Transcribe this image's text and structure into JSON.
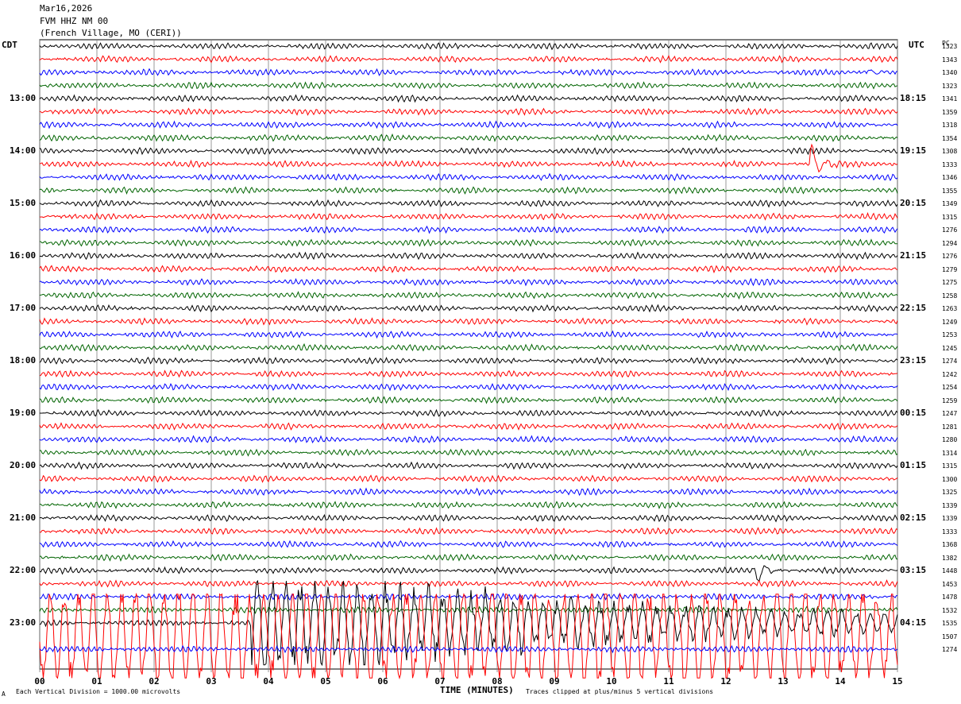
{
  "header": {
    "date": "Mar16,2026",
    "station": "FVM HHZ NM 00",
    "location": "(French Village, MO (CERI))"
  },
  "left_axis_label": "CDT",
  "right_axis_label": "UTC",
  "counts_label": "PC",
  "footer": {
    "scale_note": "Each Vertical Division = 1000.00 microvolts",
    "xlabel": "TIME (MINUTES)",
    "clip_note": "Traces clipped at plus/minus 5 vertical divisions",
    "corner_mark": "A"
  },
  "colors": {
    "line1": "#000000",
    "line2": "#ff0000",
    "line3": "#0000ff",
    "line4": "#006400",
    "grid": "#808080"
  },
  "chart_data": {
    "type": "line",
    "title": "",
    "xlabel": "TIME (MINUTES)",
    "x_ticks": [
      "00",
      "01",
      "02",
      "03",
      "04",
      "05",
      "06",
      "07",
      "08",
      "09",
      "10",
      "11",
      "12",
      "13",
      "14",
      "15"
    ],
    "xlim": [
      0,
      15
    ],
    "traces_per_hour": 4,
    "trace_minutes": 15,
    "left_hour_labels": [
      "13:00",
      "14:00",
      "15:00",
      "16:00",
      "17:00",
      "18:00",
      "19:00",
      "20:00",
      "21:00",
      "22:00",
      "23:00"
    ],
    "right_hour_labels": [
      "18:15",
      "19:15",
      "20:15",
      "21:15",
      "22:15",
      "23:15",
      "00:15",
      "01:15",
      "02:15",
      "03:15",
      "04:15"
    ],
    "trace_counts": [
      "1323",
      "1343",
      "1340",
      "1323",
      "1341",
      "1359",
      "1318",
      "1354",
      "1308",
      "1333",
      "1346",
      "1355",
      "1349",
      "1315",
      "1276",
      "1294",
      "1276",
      "1279",
      "1275",
      "1258",
      "1263",
      "1249",
      "1253",
      "1245",
      "1274",
      "1242",
      "1254",
      "1259",
      "1247",
      "1281",
      "1280",
      "1314",
      "1315",
      "1300",
      "1325",
      "1339",
      "1339",
      "1333",
      "1368",
      "1382",
      "1448",
      "1453",
      "1478",
      "1532",
      "1535",
      "1507",
      "1274"
    ],
    "series": [
      {
        "trace_index": 9,
        "event_minute": 13.45,
        "event_amplitude_divisions": 2.5
      },
      {
        "trace_index": 2,
        "event_minute": 14.45,
        "event_amplitude_divisions": 0.6
      },
      {
        "trace_index": 40,
        "event_minute": 12.5,
        "event_amplitude_divisions": 1.5
      },
      {
        "trace_index": 44,
        "event_minute": 3.7,
        "event_amplitude_divisions": 5
      },
      {
        "trace_index": 45,
        "event_minute": 0,
        "event_amplitude_divisions": 5
      }
    ],
    "clip_divisions": 5,
    "grid": true
  }
}
